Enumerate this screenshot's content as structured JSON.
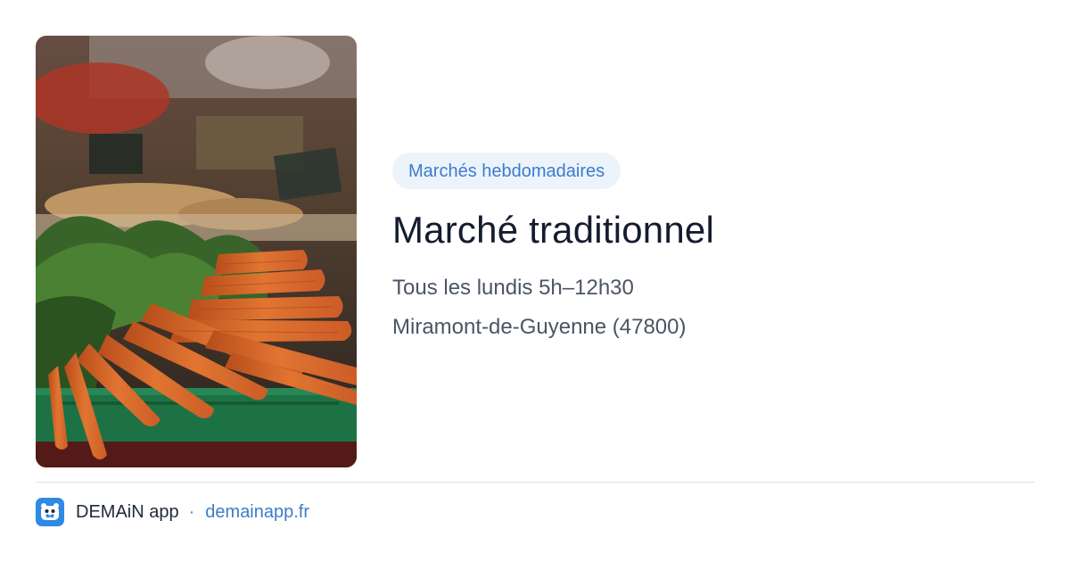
{
  "image": {
    "subject": "carrots-market-stall-photo",
    "colors": {
      "carrot": "#e8742e",
      "carrot_dark": "#c3521d",
      "leaves": "#3d6b2c",
      "crate": "#1f7a4a",
      "background_dark": "#2b2420"
    }
  },
  "market": {
    "category": "Marchés hebdomadaires",
    "title": "Marché traditionnel",
    "schedule": "Tous les lundis 5h–12h30",
    "location": "Miramont-de-Guyenne (47800)"
  },
  "footer": {
    "app_icon": "demain-app-logo-icon",
    "app_name": "DEMAiN app",
    "separator": "·",
    "link_label": "demainapp.fr"
  },
  "colors": {
    "accent": "#3d7ccc",
    "badge_bg": "#edf3fb",
    "title": "#141c2e",
    "meta": "#4b5563",
    "logo_bg": "#2f8ae6",
    "divider": "#dbe3ea"
  }
}
